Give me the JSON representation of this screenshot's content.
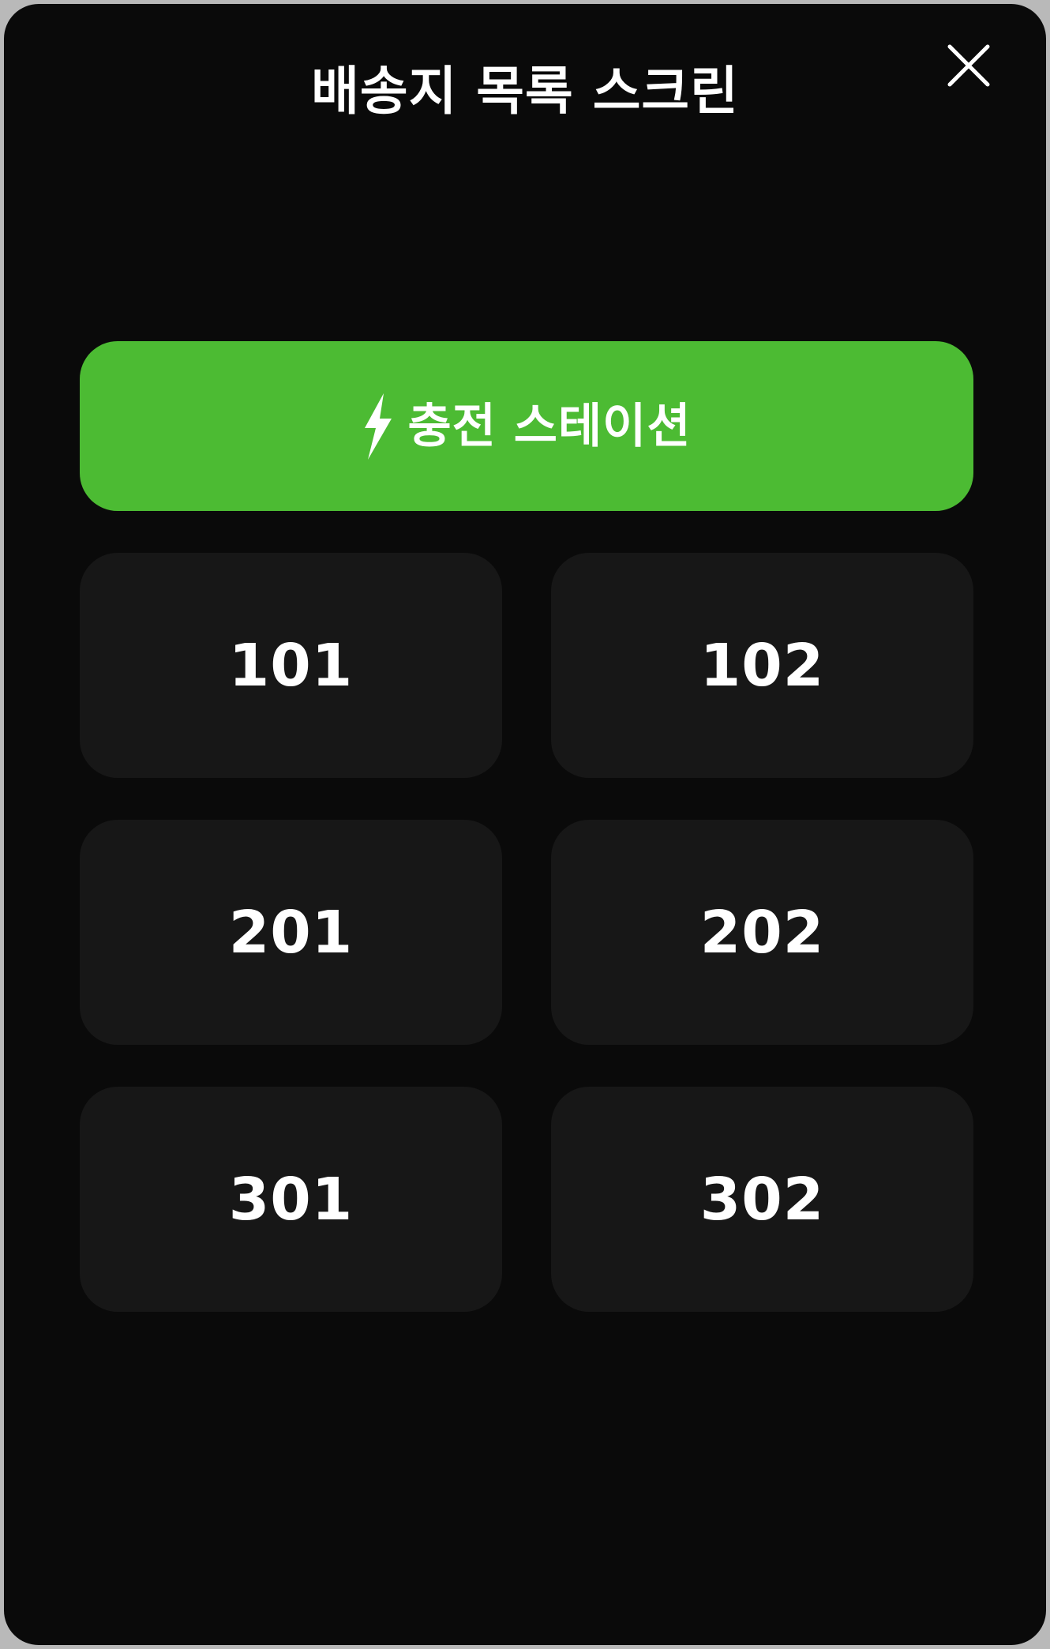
{
  "header": {
    "title": "배송지 목록 스크린",
    "close_icon": "close-icon"
  },
  "charging_station": {
    "label": "충전 스테이션",
    "icon": "lightning-bolt-icon",
    "color": "#4cbb33"
  },
  "destinations": [
    {
      "label": "101"
    },
    {
      "label": "102"
    },
    {
      "label": "201"
    },
    {
      "label": "202"
    },
    {
      "label": "301"
    },
    {
      "label": "302"
    }
  ],
  "colors": {
    "background": "#0a0a0a",
    "tile": "#171717",
    "text": "#ffffff",
    "accent": "#4cbb33"
  }
}
